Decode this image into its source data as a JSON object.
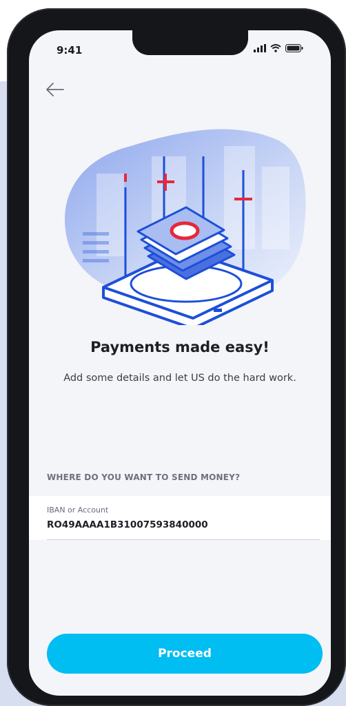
{
  "status": {
    "time": "9:41"
  },
  "hero": {
    "title": "Payments made easy!",
    "subtitle": "Add some details and let US do the hard work."
  },
  "form": {
    "section_label": "WHERE DO YOU WANT TO SEND MONEY?",
    "iban": {
      "label": "IBAN or Account",
      "value": "RO49AAAA1B31007593840000"
    }
  },
  "actions": {
    "proceed_label": "Proceed"
  },
  "colors": {
    "accent": "#00bdf2",
    "illustration_blue": "#1d4fd8",
    "illustration_red": "#e6283c"
  }
}
